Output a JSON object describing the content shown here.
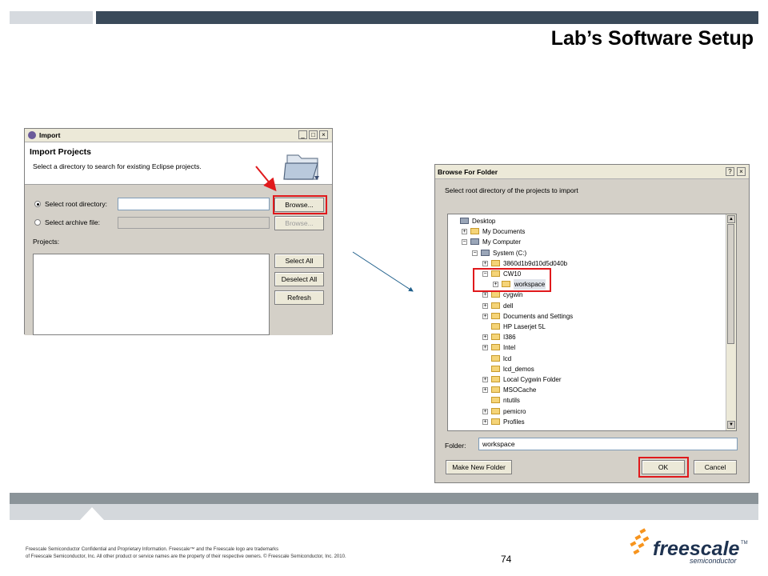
{
  "slide": {
    "title": "Lab’s Software Setup",
    "footer_line1": "Freescale Semiconductor Confidential and Proprietary Information. Freescale™ and the Freescale logo are trademarks",
    "footer_line2": "of Freescale Semiconductor, Inc. All other product or service names are the property of their respective owners. © Freescale Semiconductor, Inc. 2010.",
    "page_number": "74",
    "logo_word": "freescale",
    "logo_sub": "semiconductor",
    "logo_tm": "TM"
  },
  "import_dialog": {
    "window_title": "Import",
    "heading": "Import Projects",
    "description": "Select a directory to search for existing Eclipse projects.",
    "radio_root_label": "Select root directory:",
    "radio_archive_label": "Select archive file:",
    "root_value": "",
    "browse_label": "Browse...",
    "browse2_label": "Browse...",
    "projects_label": "Projects:",
    "select_all_label": "Select All",
    "deselect_all_label": "Deselect All",
    "refresh_label": "Refresh",
    "minimize": "_",
    "maximize": "□",
    "close": "×"
  },
  "browse_dialog": {
    "window_title": "Browse For Folder",
    "help": "?",
    "close": "×",
    "instruction": "Select root directory of the projects to import",
    "tree": [
      {
        "label": "Desktop",
        "level": 0,
        "expander": "",
        "icon": "desktop"
      },
      {
        "label": "My Documents",
        "level": 1,
        "expander": "+",
        "icon": "folder"
      },
      {
        "label": "My Computer",
        "level": 1,
        "expander": "−",
        "icon": "computer"
      },
      {
        "label": "System (C:)",
        "level": 2,
        "expander": "−",
        "icon": "drive"
      },
      {
        "label": "3860d1b9d10d5d040b",
        "level": 3,
        "expander": "+",
        "icon": "folder"
      },
      {
        "label": "CW10",
        "level": 3,
        "expander": "−",
        "icon": "folder"
      },
      {
        "label": "workspace",
        "level": 4,
        "expander": "+",
        "icon": "folder",
        "selected": true
      },
      {
        "label": "cygwin",
        "level": 3,
        "expander": "+",
        "icon": "folder"
      },
      {
        "label": "dell",
        "level": 3,
        "expander": "+",
        "icon": "folder"
      },
      {
        "label": "Documents and Settings",
        "level": 3,
        "expander": "+",
        "icon": "folder"
      },
      {
        "label": "HP Laserjet 5L",
        "level": 3,
        "expander": "",
        "icon": "folder"
      },
      {
        "label": "I386",
        "level": 3,
        "expander": "+",
        "icon": "folder"
      },
      {
        "label": "Intel",
        "level": 3,
        "expander": "+",
        "icon": "folder"
      },
      {
        "label": "lcd",
        "level": 3,
        "expander": "",
        "icon": "folder"
      },
      {
        "label": "lcd_demos",
        "level": 3,
        "expander": "",
        "icon": "folder"
      },
      {
        "label": "Local Cygwin Folder",
        "level": 3,
        "expander": "+",
        "icon": "folder"
      },
      {
        "label": "MSOCache",
        "level": 3,
        "expander": "+",
        "icon": "folder"
      },
      {
        "label": "ntutils",
        "level": 3,
        "expander": "",
        "icon": "folder"
      },
      {
        "label": "pemicro",
        "level": 3,
        "expander": "+",
        "icon": "folder"
      },
      {
        "label": "Profiles",
        "level": 3,
        "expander": "+",
        "icon": "folder"
      }
    ],
    "folder_label": "Folder:",
    "folder_value": "workspace",
    "make_new_folder_label": "Make New Folder",
    "ok_label": "OK",
    "cancel_label": "Cancel"
  },
  "annotation_colors": {
    "highlight": "#e0191c",
    "connector": "#1f5f8b"
  }
}
